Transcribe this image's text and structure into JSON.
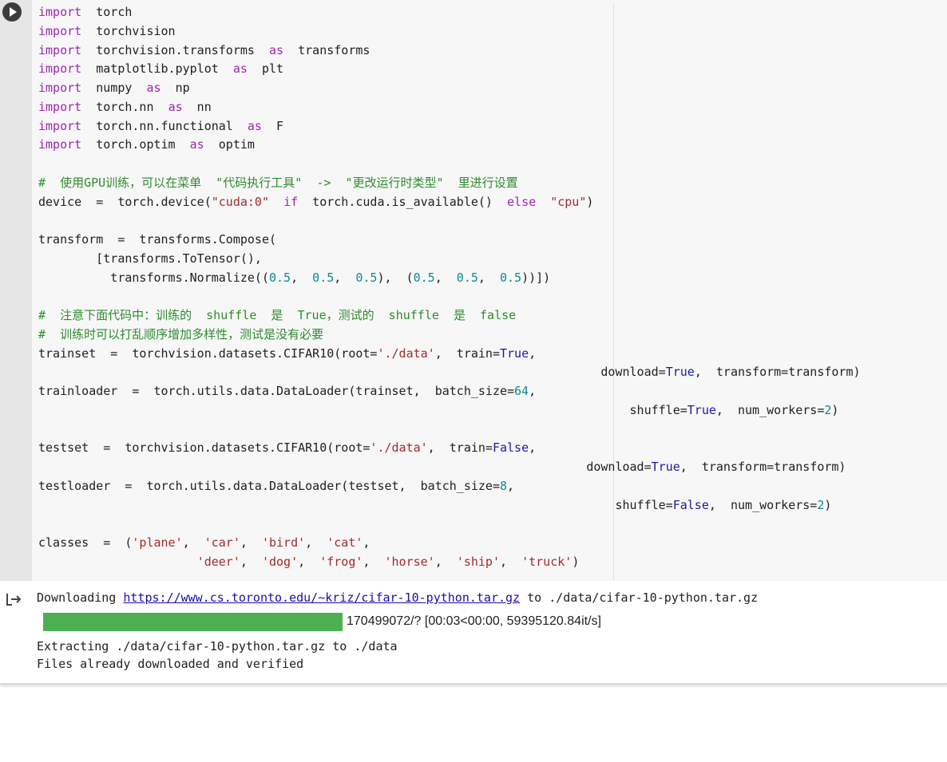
{
  "cell": {
    "code_lines": [
      [
        [
          "kw",
          "import"
        ],
        [
          "",
          "  torch"
        ]
      ],
      [
        [
          "kw",
          "import"
        ],
        [
          "",
          "  torchvision"
        ]
      ],
      [
        [
          "kw",
          "import"
        ],
        [
          "",
          "  torchvision.transforms  "
        ],
        [
          "kw",
          "as"
        ],
        [
          "",
          "  transforms"
        ]
      ],
      [
        [
          "kw",
          "import"
        ],
        [
          "",
          "  matplotlib.pyplot  "
        ],
        [
          "kw",
          "as"
        ],
        [
          "",
          "  plt"
        ]
      ],
      [
        [
          "kw",
          "import"
        ],
        [
          "",
          "  numpy  "
        ],
        [
          "kw",
          "as"
        ],
        [
          "",
          "  np"
        ]
      ],
      [
        [
          "kw",
          "import"
        ],
        [
          "",
          "  torch.nn  "
        ],
        [
          "kw",
          "as"
        ],
        [
          "",
          "  nn"
        ]
      ],
      [
        [
          "kw",
          "import"
        ],
        [
          "",
          "  torch.nn.functional  "
        ],
        [
          "kw",
          "as"
        ],
        [
          "",
          "  F"
        ]
      ],
      [
        [
          "kw",
          "import"
        ],
        [
          "",
          "  torch.optim  "
        ],
        [
          "kw",
          "as"
        ],
        [
          "",
          "  optim"
        ]
      ],
      [],
      [
        [
          "cm",
          "#  使用GPU训练，可以在菜单  \"代码执行工具\"  ->  \"更改运行时类型\"  里进行设置"
        ]
      ],
      [
        [
          "",
          "device  =  torch.device("
        ],
        [
          "st",
          "\"cuda:0\""
        ],
        [
          "",
          "  "
        ],
        [
          "kw",
          "if"
        ],
        [
          "",
          "  torch.cuda.is_available()  "
        ],
        [
          "kw",
          "else"
        ],
        [
          "",
          "  "
        ],
        [
          "st",
          "\"cpu\""
        ],
        [
          "",
          ")"
        ]
      ],
      [],
      [
        [
          "",
          "transform  =  transforms.Compose("
        ]
      ],
      [
        [
          "",
          "        [transforms.ToTensor(),"
        ]
      ],
      [
        [
          "",
          "          transforms.Normalize(("
        ],
        [
          "nm",
          "0.5"
        ],
        [
          "",
          ",  "
        ],
        [
          "nm",
          "0.5"
        ],
        [
          "",
          ",  "
        ],
        [
          "nm",
          "0.5"
        ],
        [
          "",
          "),  ("
        ],
        [
          "nm",
          "0.5"
        ],
        [
          "",
          ",  "
        ],
        [
          "nm",
          "0.5"
        ],
        [
          "",
          ",  "
        ],
        [
          "nm",
          "0.5"
        ],
        [
          "",
          "))])"
        ]
      ],
      [],
      [
        [
          "cm",
          "#  注意下面代码中：训练的  shuffle  是  True，测试的  shuffle  是  false"
        ]
      ],
      [
        [
          "cm",
          "#  训练时可以打乱顺序增加多样性，测试是没有必要"
        ]
      ],
      [
        [
          "",
          "trainset  =  torchvision.datasets.CIFAR10(root="
        ],
        [
          "st",
          "'./data'"
        ],
        [
          "",
          ",  train="
        ],
        [
          "bl",
          "True"
        ],
        [
          "",
          ","
        ]
      ],
      [
        [
          "",
          "                                                                              download="
        ],
        [
          "bl",
          "True"
        ],
        [
          "",
          ",  transform=transform)"
        ]
      ],
      [
        [
          "",
          "trainloader  =  torch.utils.data.DataLoader(trainset,  batch_size="
        ],
        [
          "nm",
          "64"
        ],
        [
          "",
          ","
        ]
      ],
      [
        [
          "",
          "                                                                                  shuffle="
        ],
        [
          "bl",
          "True"
        ],
        [
          "",
          ",  num_workers="
        ],
        [
          "nm",
          "2"
        ],
        [
          "",
          ")"
        ]
      ],
      [],
      [
        [
          "",
          "testset  =  torchvision.datasets.CIFAR10(root="
        ],
        [
          "st",
          "'./data'"
        ],
        [
          "",
          ",  train="
        ],
        [
          "bl",
          "False"
        ],
        [
          "",
          ","
        ]
      ],
      [
        [
          "",
          "                                                                            download="
        ],
        [
          "bl",
          "True"
        ],
        [
          "",
          ",  transform=transform)"
        ]
      ],
      [
        [
          "",
          "testloader  =  torch.utils.data.DataLoader(testset,  batch_size="
        ],
        [
          "nm",
          "8"
        ],
        [
          "",
          ","
        ]
      ],
      [
        [
          "",
          "                                                                                shuffle="
        ],
        [
          "bl",
          "False"
        ],
        [
          "",
          ",  num_workers="
        ],
        [
          "nm",
          "2"
        ],
        [
          "",
          ")"
        ]
      ],
      [],
      [
        [
          "",
          "classes  =  ("
        ],
        [
          "st",
          "'plane'"
        ],
        [
          "",
          ",  "
        ],
        [
          "st",
          "'car'"
        ],
        [
          "",
          ",  "
        ],
        [
          "st",
          "'bird'"
        ],
        [
          "",
          ",  "
        ],
        [
          "st",
          "'cat'"
        ],
        [
          "",
          ","
        ]
      ],
      [
        [
          "",
          "                      "
        ],
        [
          "st",
          "'deer'"
        ],
        [
          "",
          ",  "
        ],
        [
          "st",
          "'dog'"
        ],
        [
          "",
          ",  "
        ],
        [
          "st",
          "'frog'"
        ],
        [
          "",
          ",  "
        ],
        [
          "st",
          "'horse'"
        ],
        [
          "",
          ",  "
        ],
        [
          "st",
          "'ship'"
        ],
        [
          "",
          ",  "
        ],
        [
          "st",
          "'truck'"
        ],
        [
          "",
          ")"
        ]
      ]
    ]
  },
  "output": {
    "download_prefix": "Downloading ",
    "download_url": "https://www.cs.toronto.edu/~kriz/cifar-10-python.tar.gz",
    "download_suffix": " to ./data/cifar-10-python.tar.gz",
    "progress_fraction": 1.0,
    "progress_text": "170499072/? [00:03<00:00, 59395120.84it/s]",
    "extracting": "Extracting ./data/cifar-10-python.tar.gz to ./data",
    "verified": "Files already downloaded and verified"
  },
  "icons": {
    "run": "play-icon",
    "output": "output-redirect-icon"
  },
  "colors": {
    "keyword": "#9c27b0",
    "comment": "#2e8b2e",
    "string": "#a52a2a",
    "number": "#0f8a8a",
    "boolean": "#1a1aa6",
    "progress": "#4caf50"
  }
}
